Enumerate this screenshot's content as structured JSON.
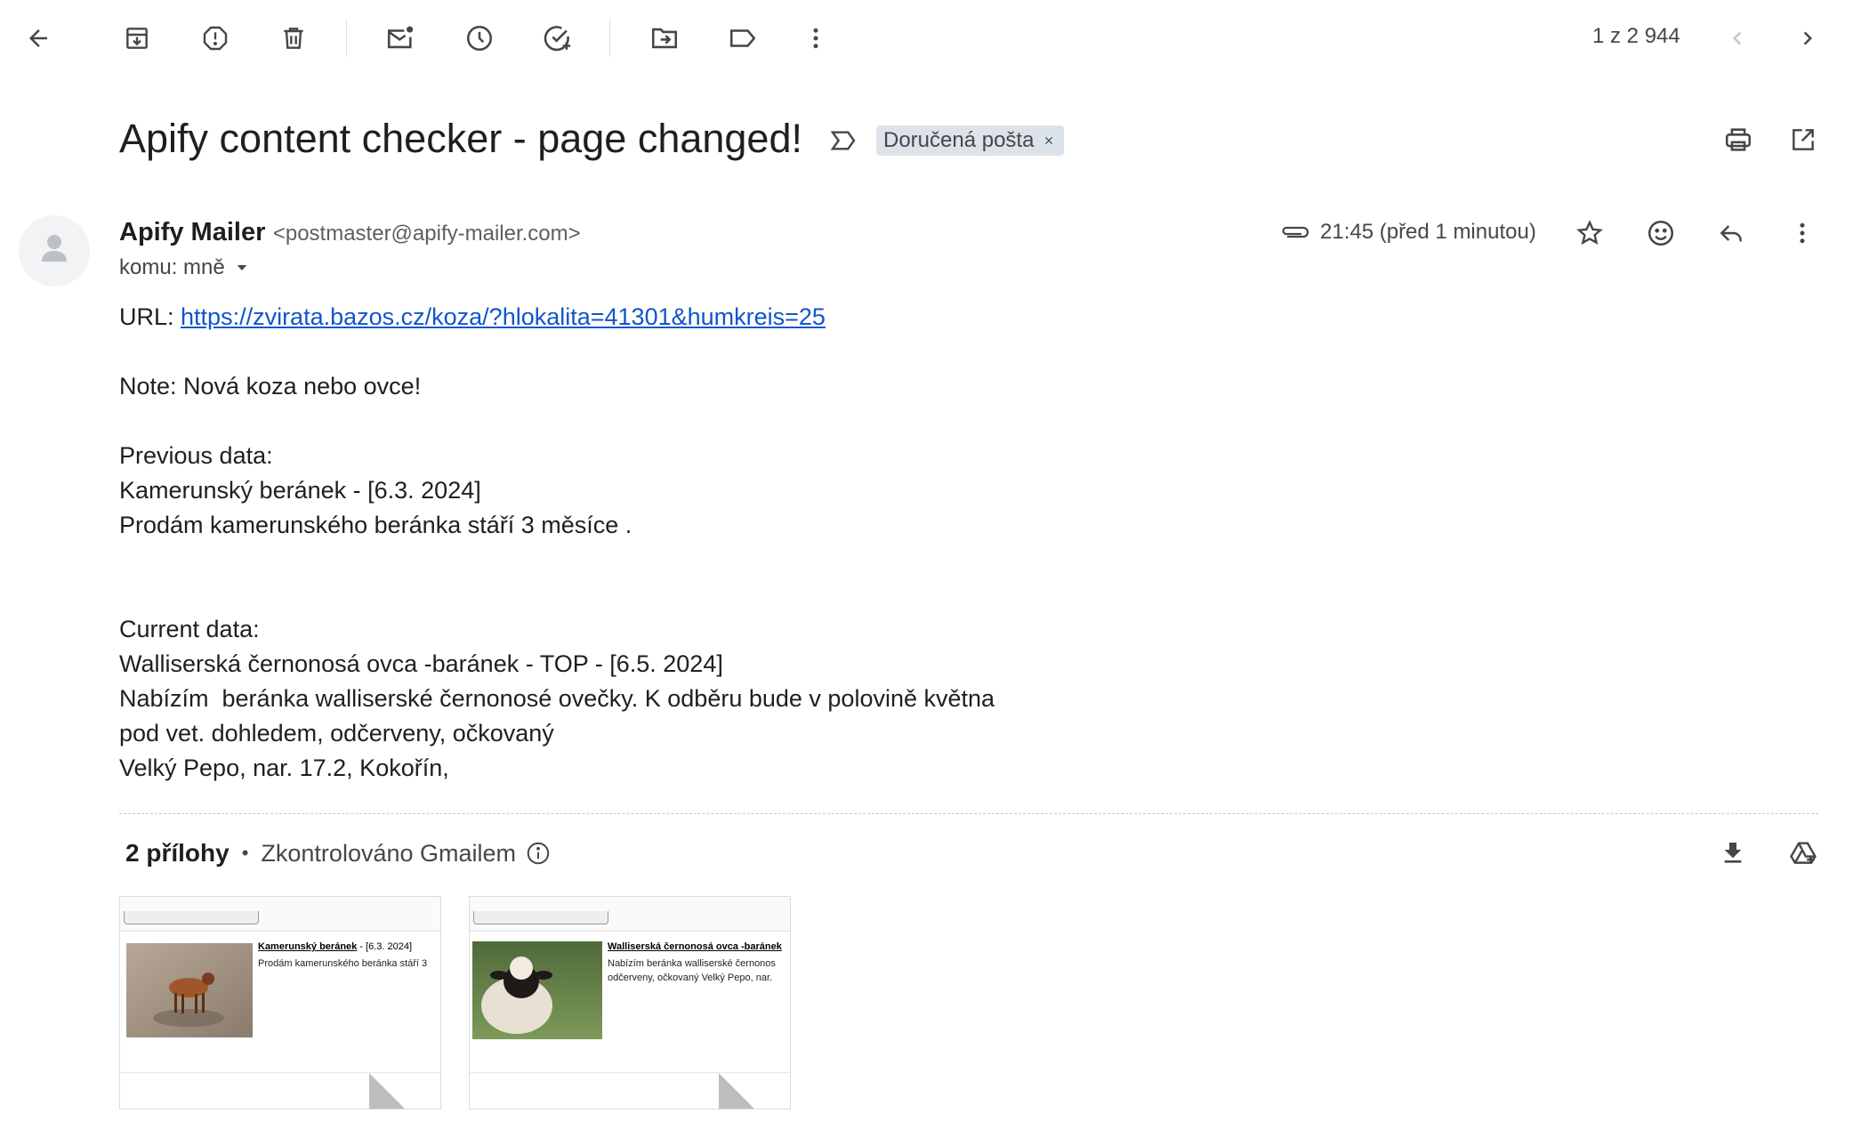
{
  "toolbar": {
    "counter": "1 z 2 944"
  },
  "subject": {
    "title": "Apify content checker - page changed!",
    "label_chip": "Doručená pošta"
  },
  "message": {
    "sender_name": "Apify Mailer",
    "sender_email": "<postmaster@apify-mailer.com>",
    "to_line": "komu: mně",
    "time": "21:45 (před 1 minutou)",
    "body": {
      "url_label": "URL: ",
      "url": "https://zvirata.bazos.cz/koza/?hlokalita=41301&humkreis=25",
      "note": "Note: Nová koza nebo ovce!",
      "prev_header": "Previous data:",
      "prev_line1": "Kamerunský beránek - [6.3. 2024]",
      "prev_line2": "Prodám kamerunského beránka stáří 3 měsíce .",
      "curr_header": "Current data:",
      "curr_line1": "Walliserská černonosá ovca -baránek - TOP - [6.5. 2024]",
      "curr_line2": "Nabízím  beránka walliserské černonosé ovečky. K odběru bude v polovině května",
      "curr_line3": "pod vet. dohledem, odčerveny, očkovaný",
      "curr_line4": "Velký Pepo, nar. 17.2, Kokořín,"
    }
  },
  "attachments": {
    "count_label": "2 přílohy",
    "scan_label": "Zkontrolováno Gmailem",
    "items": [
      {
        "title": "Kamerunský beránek",
        "date": " - [6.3. 2024]",
        "desc1": "Prodám kamerunského beránka stáří 3",
        "desc2": ""
      },
      {
        "title": "Walliserská černonosá ovca -baránek",
        "date": "",
        "desc1": "Nabízím beránka walliserské černonos",
        "desc2": "odčerveny, očkovaný Velký Pepo, nar."
      }
    ]
  },
  "colors": {
    "link": "#1155cc",
    "chip_bg": "#dde3ea",
    "icon": "#444746"
  }
}
